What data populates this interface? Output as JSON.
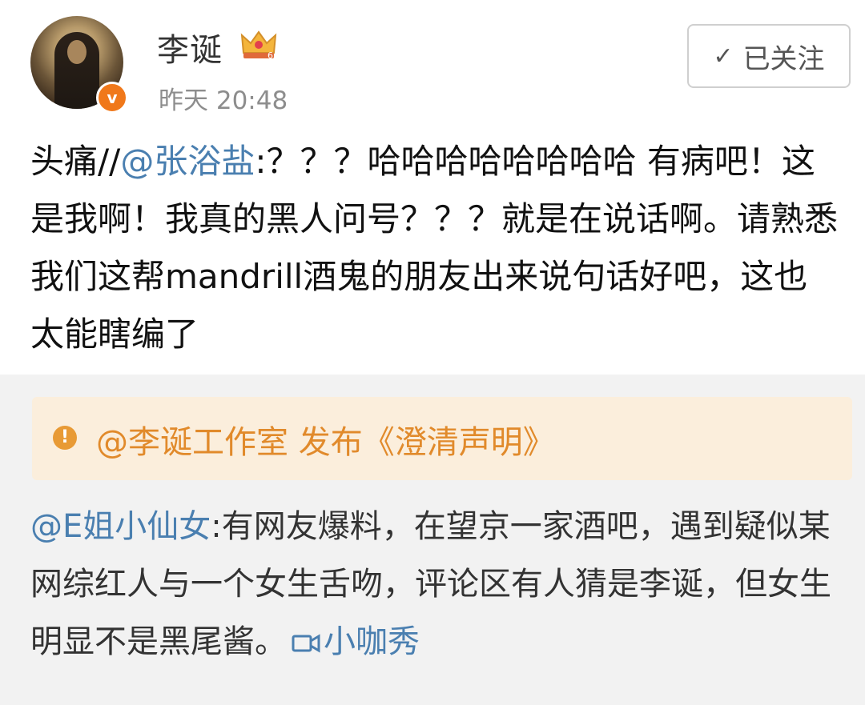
{
  "header": {
    "username": "李诞",
    "time": "昨天 20:48",
    "verified_badge": "v",
    "follow_label": "已关注",
    "icons": {
      "avatar": "profile-photo",
      "crown": "crown-icon",
      "check": "check-icon"
    }
  },
  "post": {
    "prefix": "头痛//",
    "mention": "@张浴盐",
    "body": ":？？？哈哈哈哈哈哈哈哈 有病吧！这是我啊！我真的黑人问号？？？就是在说话啊。请熟悉我们这帮mandrill酒鬼的朋友出来说句话好吧，这也太能瞎编了"
  },
  "repost": {
    "notice_text": "@李诞工作室 发布《澄清声明》",
    "notice_icon": "!",
    "mention": "@E姐小仙女",
    "body": ":有网友爆料，在望京一家酒吧，遇到疑似某网综红人与一个女生舌吻，评论区有人猜是李诞，但女生明显不是黑尾酱。",
    "video_icon": "video-icon",
    "video_label": "小咖秀"
  },
  "colors": {
    "link": "#4a7fb0",
    "notice_text": "#e18a2b",
    "notice_bg": "#fbeedc",
    "verified": "#f0781a"
  }
}
